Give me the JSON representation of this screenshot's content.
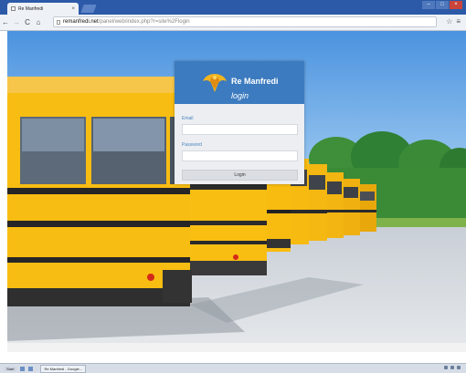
{
  "browser": {
    "tab_title": "Re Manfredi",
    "tab_close": "×",
    "back_icon": "back-arrow-icon",
    "url_host": "remanfredi.net",
    "url_path": "/panel/web/index.php?r=site%2Flogin"
  },
  "login": {
    "brand": "Re Manfredi",
    "title": "login",
    "email_label": "Email",
    "email_value": "",
    "password_label": "Password",
    "password_value": "",
    "button_label": "Login",
    "accent_color": "#3c7bbf"
  },
  "taskbar": {
    "start_label": "Start",
    "task_label": "Re Manfredi - Google..."
  }
}
